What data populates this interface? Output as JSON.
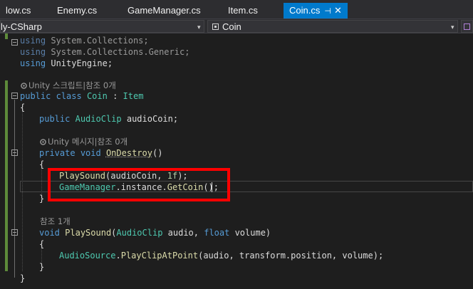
{
  "tabs": [
    {
      "label": "low.cs"
    },
    {
      "label": "Enemy.cs"
    },
    {
      "label": "GameManager.cs"
    },
    {
      "label": "Item.cs"
    },
    {
      "label": "Coin.cs",
      "pin_glyph": "⊣",
      "close_glyph": "✕"
    }
  ],
  "nav": {
    "project": "ly-CSharp",
    "class": "Coin",
    "dropdown_glyph": "▾"
  },
  "code": {
    "l1": {
      "kw": "using",
      "rest": " System.Collections;"
    },
    "l2": {
      "kw": "using",
      "rest": " System.Collections.Generic;"
    },
    "l3": {
      "kw": "using",
      "rest": " UnityEngine;"
    },
    "lens1": "Unity 스크립트|참조 0개",
    "l5": {
      "kw1": "public",
      "kw2": "class",
      "name": "Coin",
      "sep": " : ",
      "base": "Item"
    },
    "l6": "{",
    "l7": {
      "kw": "public",
      "type": "AudioClip",
      "rest": " audioCoin;"
    },
    "lens2": "Unity 메시지|참조 0개",
    "l9": {
      "kw1": "private",
      "kw2": "void",
      "name": "OnDestroy",
      "rest": "()"
    },
    "l10": "{",
    "l11": {
      "fn": "PlaySound",
      "p1": "(audioCoin, ",
      "num": "1f",
      "p2": ");"
    },
    "l12": {
      "type": "GameManager",
      "mid": ".instance.",
      "fn": "GetCoin",
      "rest": "();"
    },
    "l13": "}",
    "lens3": "참조 1개",
    "l15": {
      "kw": "void",
      "fn": "PlaySound",
      "p1": "(",
      "type": "AudioClip",
      "p2": " audio, ",
      "kw2": "float",
      "p3": " volume)"
    },
    "l16": "{",
    "l17": {
      "type": "AudioSource",
      "dot": ".",
      "fn": "PlayClipAtPoint",
      "rest": "(audio, transform.position, volume);"
    },
    "l18": "}",
    "l19": "}"
  },
  "colors": {
    "background": "#1e1e1e",
    "keyword": "#569cd6",
    "type": "#4ec9b0",
    "method": "#dcdcaa",
    "number": "#b5cea8",
    "active_tab": "#007acc",
    "highlight_box": "#ff0000",
    "changed_margin": "#5d8a3a"
  },
  "icons": {
    "codelens": "gear-icon",
    "class": "class-icon"
  }
}
